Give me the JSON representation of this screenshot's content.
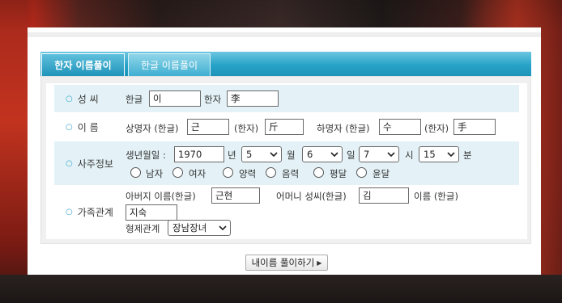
{
  "tabs": [
    {
      "label": "한자 이름풀이",
      "active": true
    },
    {
      "label": "한글 이름풀이",
      "active": false
    }
  ],
  "surname_row": {
    "label": "성 씨",
    "hangul_label": "한글",
    "hangul_value": "이",
    "hanja_label": "한자",
    "hanja_value": "李"
  },
  "name_row": {
    "label": "이 름",
    "upper_label": "상명자 (한글)",
    "upper_hangul": "근",
    "upper_hanja_label": "(한자)",
    "upper_hanja": "斤",
    "lower_label": "하명자 (한글)",
    "lower_hangul": "수",
    "lower_hanja_label": "(한자)",
    "lower_hanja": "手"
  },
  "saju_row": {
    "label": "사주정보",
    "birth_label": "생년월일 :",
    "year": "1970",
    "year_unit": "년",
    "month": "5",
    "month_unit": "월",
    "day": "6",
    "day_unit": "일",
    "hour": "7",
    "hour_unit": "시",
    "minute": "15",
    "minute_unit": "분",
    "radios": [
      "남자",
      "여자",
      "양력",
      "음력",
      "평달",
      "윤달"
    ]
  },
  "family_row": {
    "label": "가족관계",
    "father_label": "아버지 이름(한글)",
    "father_value": "근현",
    "mother_surname_label": "어머니 성씨(한글)",
    "mother_surname_value": "김",
    "mother_name_label": "이름 (한글)",
    "mother_name_value": "지숙",
    "sibling_label": "형제관계",
    "sibling_value": "장남장녀"
  },
  "submit_label": "내이름 풀이하기",
  "colors": {
    "tab_blue": "#28a3c8",
    "row_shade": "#e4f2f7",
    "bullet": "#35a6c9"
  }
}
